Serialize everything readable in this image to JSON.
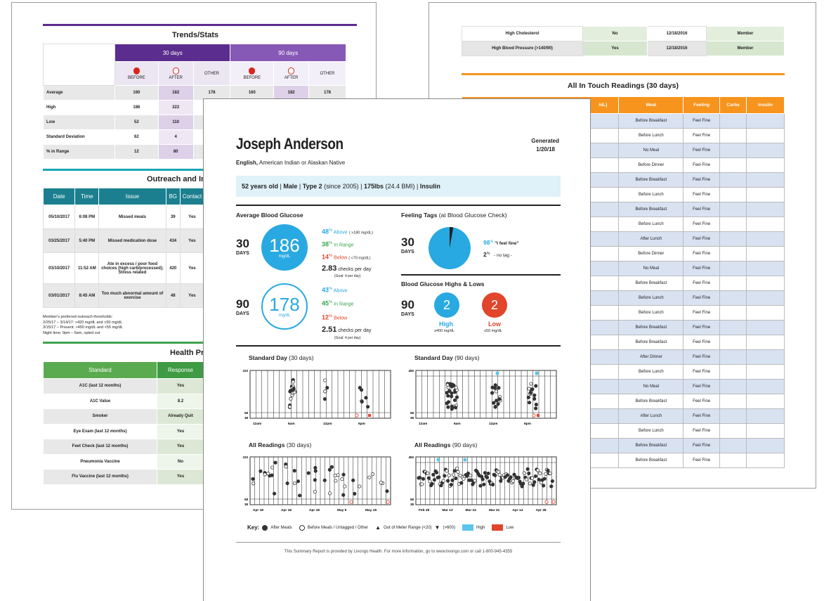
{
  "left_page": {
    "trends_title": "Trends/Stats",
    "period_30": "30 days",
    "period_90": "90 days",
    "sub_cols": [
      "BEFORE",
      "AFTER",
      "OTHER",
      "BEFORE",
      "AFTER",
      "OTHER"
    ],
    "stats_rows": [
      {
        "label": "Average",
        "values": [
          "160",
          "182",
          "178",
          "160",
          "182",
          "178"
        ]
      },
      {
        "label": "High",
        "values": [
          "186",
          "322",
          "",
          "",
          "",
          ""
        ]
      },
      {
        "label": "Low",
        "values": [
          "52",
          "110",
          "",
          "",
          "",
          ""
        ]
      },
      {
        "label": "Standard Deviation",
        "values": [
          "62",
          "4",
          "",
          "",
          "",
          ""
        ]
      },
      {
        "label": "% in Range",
        "values": [
          "12",
          "80",
          "",
          "",
          "",
          ""
        ]
      }
    ],
    "outreach_title": "Outreach and In",
    "outreach_headers": [
      "Date",
      "Time",
      "Issue",
      "BG",
      "Contact"
    ],
    "outreach_rows": [
      {
        "date": "05/10/2017",
        "time": "6:08 PM",
        "issue": "Missed meals",
        "bg": "39",
        "contact": "Yes"
      },
      {
        "date": "03/25/2017",
        "time": "5:40 PM",
        "issue": "Missed medication dose",
        "bg": "434",
        "contact": "Yes"
      },
      {
        "date": "03/10/2017",
        "time": "11:52 AM",
        "issue": "Ate in excess / poor food choices (high carb/processed); Stress related",
        "bg": "420",
        "contact": "Yes"
      },
      {
        "date": "03/01/2017",
        "time": "8:45 AM",
        "issue": "Too much abnormal amount of exercise",
        "bg": "48",
        "contact": "Yes"
      }
    ],
    "threshold_lines": [
      "Member's preferred outreach thresholds:",
      "2/25/17 – 3/14/17: >420 mg/dL and <50 mg/dL",
      "3/15/17 – Present: >450 mg/dL and <55 mg/dL",
      "Night time: 9pm – 6am, opted out"
    ],
    "health_title": "Health Pr",
    "health_headers": [
      "Standard",
      "Response"
    ],
    "health_rows": [
      {
        "standard": "A1C (last 12 months)",
        "response": "Yes"
      },
      {
        "standard": "A1C Value",
        "response": "8.2"
      },
      {
        "standard": "Smoker",
        "response": "Already Quit"
      },
      {
        "standard": "Eye Exam (last 12 months)",
        "response": "Yes"
      },
      {
        "standard": "Feet Check (last 12 months)",
        "response": "Yes"
      },
      {
        "standard": "Pneumonia Vaccine",
        "response": "No"
      },
      {
        "standard": "Flu Vaccine (last 12 months)",
        "response": "Yes"
      }
    ]
  },
  "right_page": {
    "conditions": [
      {
        "name": "High Cholesterol",
        "has": "No",
        "date": "12/18/2016",
        "source": "Member"
      },
      {
        "name": "High Blood Pressure (>140/90)",
        "has": "Yes",
        "date": "12/18/2016",
        "source": "Member"
      }
    ],
    "readings_title": "All In Touch Readings (30 days)",
    "readings_headers": [
      "/dL)",
      "Meal",
      "Feeling",
      "Carbs",
      "Insulin"
    ],
    "readings": [
      {
        "meal": "Before Breakfast",
        "feeling": "Feel Fine"
      },
      {
        "meal": "Before Lunch",
        "feeling": "Feel Fine"
      },
      {
        "meal": "No Meal",
        "feeling": "Feel Fine"
      },
      {
        "meal": "Before Dinner",
        "feeling": "Feel Fine"
      },
      {
        "meal": "Before Breakfast",
        "feeling": "Feel Fine"
      },
      {
        "meal": "Before Lunch",
        "feeling": "Feel Fine"
      },
      {
        "meal": "Before Breakfast",
        "feeling": "Feel Fine"
      },
      {
        "meal": "Before Lunch",
        "feeling": "Feel Fine"
      },
      {
        "meal": "After Lunch",
        "feeling": "Feel Fine"
      },
      {
        "meal": "Before Dinner",
        "feeling": "Feel Fine"
      },
      {
        "meal": "No Meal",
        "feeling": "Feel Fine"
      },
      {
        "meal": "Before Breakfast",
        "feeling": "Feel Fine"
      },
      {
        "meal": "Before Lunch",
        "feeling": "Feel Fine"
      },
      {
        "meal": "Before Lunch",
        "feeling": "Feel Fine"
      },
      {
        "meal": "Before Breakfast",
        "feeling": "Feel Fine"
      },
      {
        "meal": "Before Breakfast",
        "feeling": "Feel Fine"
      },
      {
        "meal": "After Dinner",
        "feeling": "Feel Fine"
      },
      {
        "meal": "Before Lunch",
        "feeling": "Feel Fine"
      },
      {
        "meal": "No Meal",
        "feeling": "Feel Fine"
      },
      {
        "meal": "Before Breakfast",
        "feeling": "Feel Fine"
      },
      {
        "meal": "After Lunch",
        "feeling": "Feel Fine"
      },
      {
        "meal": "Before Lunch",
        "feeling": "Feel Fine"
      },
      {
        "meal": "Before Breakfast",
        "feeling": "Feel Fine"
      },
      {
        "meal": "Before Breakfast",
        "feeling": "Feel Fine"
      }
    ]
  },
  "front_page": {
    "patient_name": "Joseph Anderson",
    "generated_label": "Generated",
    "generated_date": "1/20/18",
    "language": "English,",
    "ethnicity": " American Indian or Alaskan Native",
    "summary": {
      "age": "52 years old",
      "sep": " | ",
      "sex": "Male",
      "type": "Type 2",
      "since": " (since 2005)",
      "weight": "175lbs",
      "bmi": " (24.4 BMI)",
      "therapy": "Insulin"
    },
    "avg_bg_title": "Average Blood Glucose",
    "p30": {
      "num": "30",
      "unit": "DAYS",
      "avg": "186",
      "avg_unit": "mg/dL",
      "above_pct": "48",
      "above_label": "Above",
      "above_range": "( >180 mg/dL)",
      "in_pct": "38",
      "in_label": "In Range",
      "below_pct": "14",
      "below_label": "Below",
      "below_range": "( <70 mg/dL)",
      "checks": "2.83",
      "checks_label": "checks per day",
      "goal": "(Goal: 4 per day)"
    },
    "p90": {
      "num": "90",
      "unit": "DAYS",
      "avg": "178",
      "avg_unit": "mg/dL",
      "above_pct": "43",
      "above_label": "Above",
      "in_pct": "45",
      "in_label": "In Range",
      "below_pct": "12",
      "below_label": "Below",
      "checks": "2.51",
      "checks_label": "checks per day",
      "goal": "(Goal: 4 per day)"
    },
    "feeling_title": "Feeling Tags",
    "feeling_sub": " (at Blood Glucose Check)",
    "feeling_num": "30",
    "feeling_unit": "DAYS",
    "feeling_fine_pct": "98",
    "feeling_fine_label": "\"I feel fine\"",
    "feeling_none_pct": "2",
    "feeling_none_label": "- no tag -",
    "hl_title": "Blood Glucose Highs & Lows",
    "hl_num": "90",
    "hl_unit": "DAYS",
    "high_count": "2",
    "high_label": "High",
    "high_sub": "≥400 mg/dL",
    "low_count": "2",
    "low_label": "Low",
    "low_sub": "≤50 mg/dL",
    "std30_title": "Standard Day",
    "std30_sub": " (30 days)",
    "std90_title": "Standard Day",
    "std90_sub": " (90 days)",
    "all30_title": "All Readings",
    "all30_sub": " (30 days)",
    "all90_title": "All Readings",
    "all90_sub": " (90 days)",
    "std_ticks": [
      "12am",
      "6am",
      "12pm",
      "6pm"
    ],
    "all30_ticks": [
      "Apr 18",
      "Apr 18",
      "Apr 18",
      "May 9",
      "May 18"
    ],
    "all90_ticks": [
      "Feb 28",
      "Mar 13",
      "Mar 24",
      "Mar 31",
      "Apr 14",
      "Apr 28"
    ],
    "y30": [
      "310",
      "58",
      "38"
    ],
    "y90": [
      "450",
      "58",
      "38"
    ],
    "key": {
      "label": "Key:",
      "after": "After Meals",
      "before": "Before Meals / Untagged / Other",
      "out": "Out of Meter Range (<20)",
      "out2": "(>600)",
      "high": "High",
      "low": "Low"
    },
    "footer": "This Summary Report is provided by Livongo Health. For more information, go to www.livongo.com or call 1-800-945-4355"
  },
  "colors": {
    "purple": "#5b2d8e",
    "teal": "#1b7f8f",
    "green": "#5aab4f",
    "orange": "#f7941d",
    "blue": "#29a9e1",
    "red": "#e1452c",
    "in_range": "#37a64a",
    "summary_bg": "#dff1f9"
  }
}
